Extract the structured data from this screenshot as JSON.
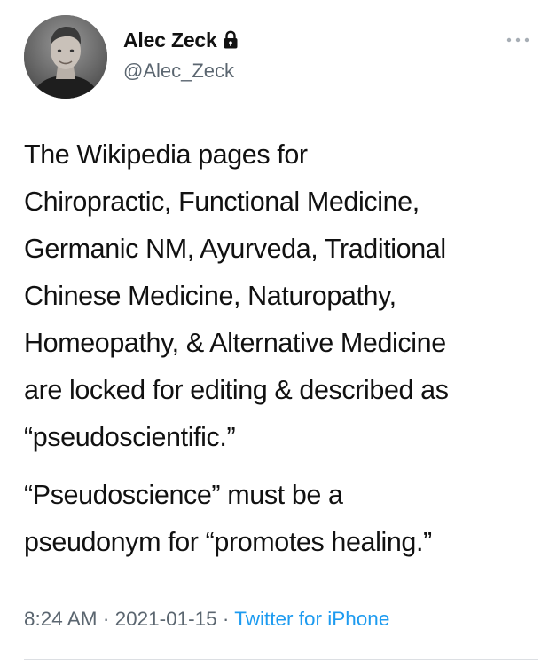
{
  "author": {
    "display_name": "Alec Zeck",
    "handle": "@Alec_Zeck",
    "protected_icon": "lock-icon",
    "avatar_icon": "profile-photo"
  },
  "menu": {
    "icon": "more-dots-icon"
  },
  "tweet": {
    "paragraphs": [
      "The Wikipedia pages for\nChiropractic, Functional Medicine,\nGermanic NM, Ayurveda, Traditional\nChinese Medicine, Naturopathy,\nHomeopathy, & Alternative Medicine\nare locked for editing & described as\n“pseudoscientific.”",
      "“Pseudoscience” must be a\npseudonym for “promotes healing.”"
    ],
    "time": "8:24 AM",
    "separator": " · ",
    "date": "2021-01-15",
    "source": "Twitter for iPhone"
  },
  "colors": {
    "text": "#111111",
    "secondary": "#5b6670",
    "link": "#1d9bf0",
    "divider": "#dcdfe3"
  }
}
